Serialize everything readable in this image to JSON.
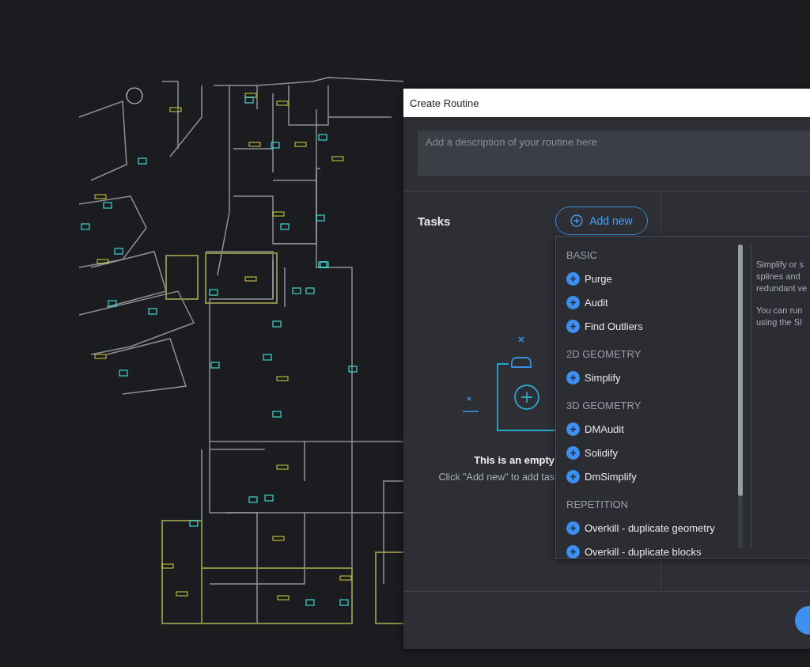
{
  "dialog": {
    "title": "Create Routine",
    "description_field": {
      "placeholder": "Add a description of your routine here"
    },
    "tasks": {
      "heading": "Tasks",
      "add_button": "Add new",
      "empty_title": "This is an empty",
      "empty_hint": "Click \"Add new\" to add tas"
    },
    "task_menu": {
      "groups": [
        {
          "heading": "BASIC",
          "items": [
            "Purge",
            "Audit",
            "Find Outliers"
          ]
        },
        {
          "heading": "2D GEOMETRY",
          "items": [
            "Simplify"
          ]
        },
        {
          "heading": "3D GEOMETRY",
          "items": [
            "DMAudit",
            "Solidify",
            "DmSimplify"
          ]
        },
        {
          "heading": "REPETITION",
          "items": [
            "Overkill - duplicate geometry",
            "Overkill - duplicate blocks"
          ]
        }
      ],
      "description": [
        [
          "Simplify or s",
          "splines and",
          "redundant ve"
        ],
        [
          "You can run",
          "using the SI"
        ]
      ]
    }
  }
}
